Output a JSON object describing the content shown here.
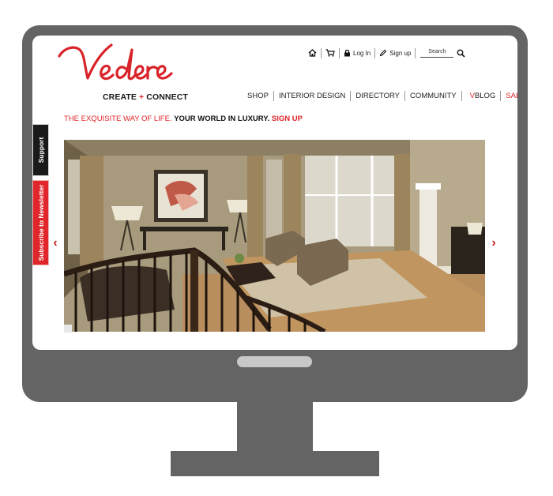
{
  "brand": {
    "name": "Vedere",
    "tagline_left": "CREATE",
    "tagline_plus": "+",
    "tagline_right": "CONNECT"
  },
  "utility": {
    "login_label": "Log In",
    "signup_label": "Sign up",
    "search_placeholder": "Search"
  },
  "nav": {
    "items": [
      {
        "label": "SHOP"
      },
      {
        "label": "INTERIOR DESIGN"
      },
      {
        "label": "DIRECTORY"
      },
      {
        "label": "COMMUNITY"
      }
    ],
    "vblog_v": "V",
    "vblog_rest": "BLOG",
    "sale": "SALE"
  },
  "headline": {
    "part1": "THE EXQUISITE WAY OF LIFE.",
    "part2": "YOUR WORLD IN LUXURY.",
    "part3": "SIGN UP"
  },
  "side_tabs": {
    "support": "Support",
    "newsletter": "Subscribe to Newsletter"
  },
  "colors": {
    "accent": "#e0262b",
    "monitor": "#646464"
  }
}
